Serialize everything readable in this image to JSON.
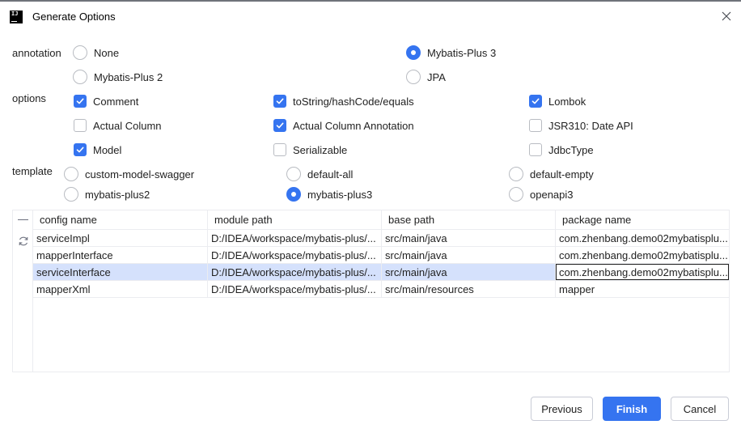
{
  "window": {
    "title": "Generate Options",
    "app_icon": "IJ"
  },
  "annotation": {
    "label": "annotation",
    "options": [
      {
        "label": "None",
        "selected": false
      },
      {
        "label": "Mybatis-Plus 3",
        "selected": true
      },
      {
        "label": "Mybatis-Plus 2",
        "selected": false
      },
      {
        "label": "JPA",
        "selected": false
      }
    ]
  },
  "options": {
    "label": "options",
    "items": [
      {
        "label": "Comment",
        "checked": true
      },
      {
        "label": "toString/hashCode/equals",
        "checked": true
      },
      {
        "label": "Lombok",
        "checked": true
      },
      {
        "label": "Actual Column",
        "checked": false
      },
      {
        "label": "Actual Column Annotation",
        "checked": true
      },
      {
        "label": "JSR310: Date API",
        "checked": false
      },
      {
        "label": "Model",
        "checked": true
      },
      {
        "label": "Serializable",
        "checked": false
      },
      {
        "label": "JdbcType",
        "checked": false
      }
    ]
  },
  "template": {
    "label": "template",
    "options": [
      {
        "label": "custom-model-swagger",
        "selected": false
      },
      {
        "label": "default-all",
        "selected": false
      },
      {
        "label": "default-empty",
        "selected": false
      },
      {
        "label": "mybatis-plus2",
        "selected": false
      },
      {
        "label": "mybatis-plus3",
        "selected": true
      },
      {
        "label": "openapi3",
        "selected": false
      }
    ]
  },
  "table": {
    "columns": [
      "config name",
      "module path",
      "base path",
      "package name"
    ],
    "rows": [
      [
        "serviceImpl",
        "D:/IDEA/workspace/mybatis-plus/...",
        "src/main/java",
        "com.zhenbang.demo02mybatisplu..."
      ],
      [
        "mapperInterface",
        "D:/IDEA/workspace/mybatis-plus/...",
        "src/main/java",
        "com.zhenbang.demo02mybatisplu..."
      ],
      [
        "serviceInterface",
        "D:/IDEA/workspace/mybatis-plus/...",
        "src/main/java",
        "com.zhenbang.demo02mybatisplu..."
      ],
      [
        "mapperXml",
        "D:/IDEA/workspace/mybatis-plus/...",
        "src/main/resources",
        "mapper"
      ]
    ],
    "selected_row": 2
  },
  "buttons": {
    "previous": "Previous",
    "finish": "Finish",
    "cancel": "Cancel"
  },
  "colors": {
    "accent": "#3574f0",
    "selection": "#d5e1fc"
  },
  "icons": {
    "close": "close-icon",
    "minus": "minus-icon",
    "refresh": "refresh-icon",
    "check": "checkmark-icon"
  }
}
